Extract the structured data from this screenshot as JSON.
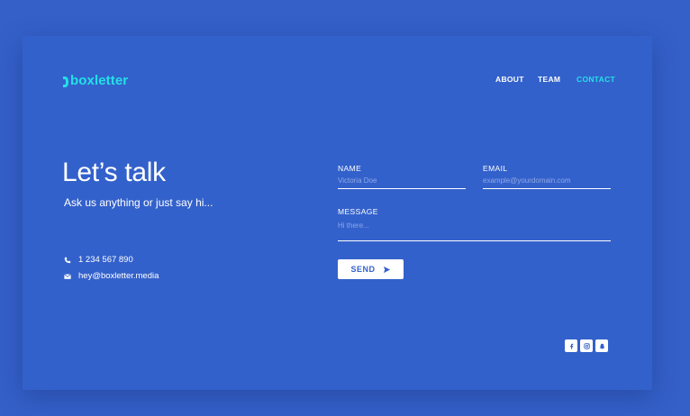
{
  "brand": {
    "name": "boxletter",
    "accent": "#23e0e6"
  },
  "nav": {
    "about": "ABOUT",
    "team": "TEAM",
    "contact": "CONTACT"
  },
  "hero": {
    "title": "Let’s talk",
    "subtitle": "Ask us anything or just say hi..."
  },
  "contact_info": {
    "phone": "1 234 567 890",
    "email": "hey@boxletter.media"
  },
  "form": {
    "name_label": "NAME",
    "name_placeholder": "Victoria Doe",
    "email_label": "EMAIL",
    "email_placeholder": "example@yourdomain.com",
    "message_label": "MESSAGE",
    "message_placeholder": "Hi there...",
    "send_label": "SEND"
  },
  "social": [
    "facebook-icon",
    "instagram-icon",
    "snapchat-icon"
  ],
  "colors": {
    "background": "#3460c8",
    "card": "#3361cb",
    "text": "#ffffff"
  }
}
